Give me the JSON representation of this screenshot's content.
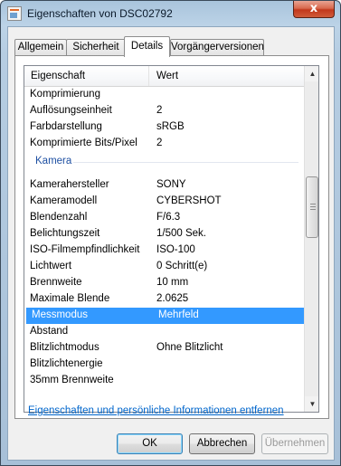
{
  "window": {
    "title": "Eigenschaften von DSC02792",
    "close_glyph": "x"
  },
  "tabs": [
    {
      "label": "Allgemein"
    },
    {
      "label": "Sicherheit"
    },
    {
      "label": "Details"
    },
    {
      "label": "Vorgängerversionen"
    }
  ],
  "active_tab": "Details",
  "table": {
    "headers": {
      "property": "Eigenschaft",
      "value": "Wert"
    },
    "rows_before": [
      {
        "k": "Komprimierung",
        "v": ""
      },
      {
        "k": "Auflösungseinheit",
        "v": "2"
      },
      {
        "k": "Farbdarstellung",
        "v": "sRGB"
      },
      {
        "k": "Komprimierte Bits/Pixel",
        "v": "2"
      }
    ],
    "group_label": "Kamera",
    "rows_after": [
      {
        "k": "Kamerahersteller",
        "v": "SONY"
      },
      {
        "k": "Kameramodell",
        "v": "CYBERSHOT"
      },
      {
        "k": "Blendenzahl",
        "v": "F/6.3"
      },
      {
        "k": "Belichtungszeit",
        "v": "1/500 Sek."
      },
      {
        "k": "ISO-Filmempfindlichkeit",
        "v": "ISO-100"
      },
      {
        "k": "Lichtwert",
        "v": "0 Schritt(e)"
      },
      {
        "k": "Brennweite",
        "v": "10 mm"
      },
      {
        "k": "Maximale Blende",
        "v": "2.0625"
      },
      {
        "k": "Messmodus",
        "v": "Mehrfeld"
      },
      {
        "k": "Abstand",
        "v": ""
      },
      {
        "k": "Blitzlichtmodus",
        "v": "Ohne Blitzlicht"
      },
      {
        "k": "Blitzlichtenergie",
        "v": ""
      },
      {
        "k": "35mm Brennweite",
        "v": ""
      }
    ],
    "selected_row": "Messmodus"
  },
  "link_text": "Eigenschaften und persönliche Informationen entfernen",
  "buttons": {
    "ok": "OK",
    "cancel": "Abbrechen",
    "apply": "Übernehmen"
  },
  "colors": {
    "selection": "#3399ff",
    "link": "#0066cc",
    "group_label": "#1e50a2"
  }
}
